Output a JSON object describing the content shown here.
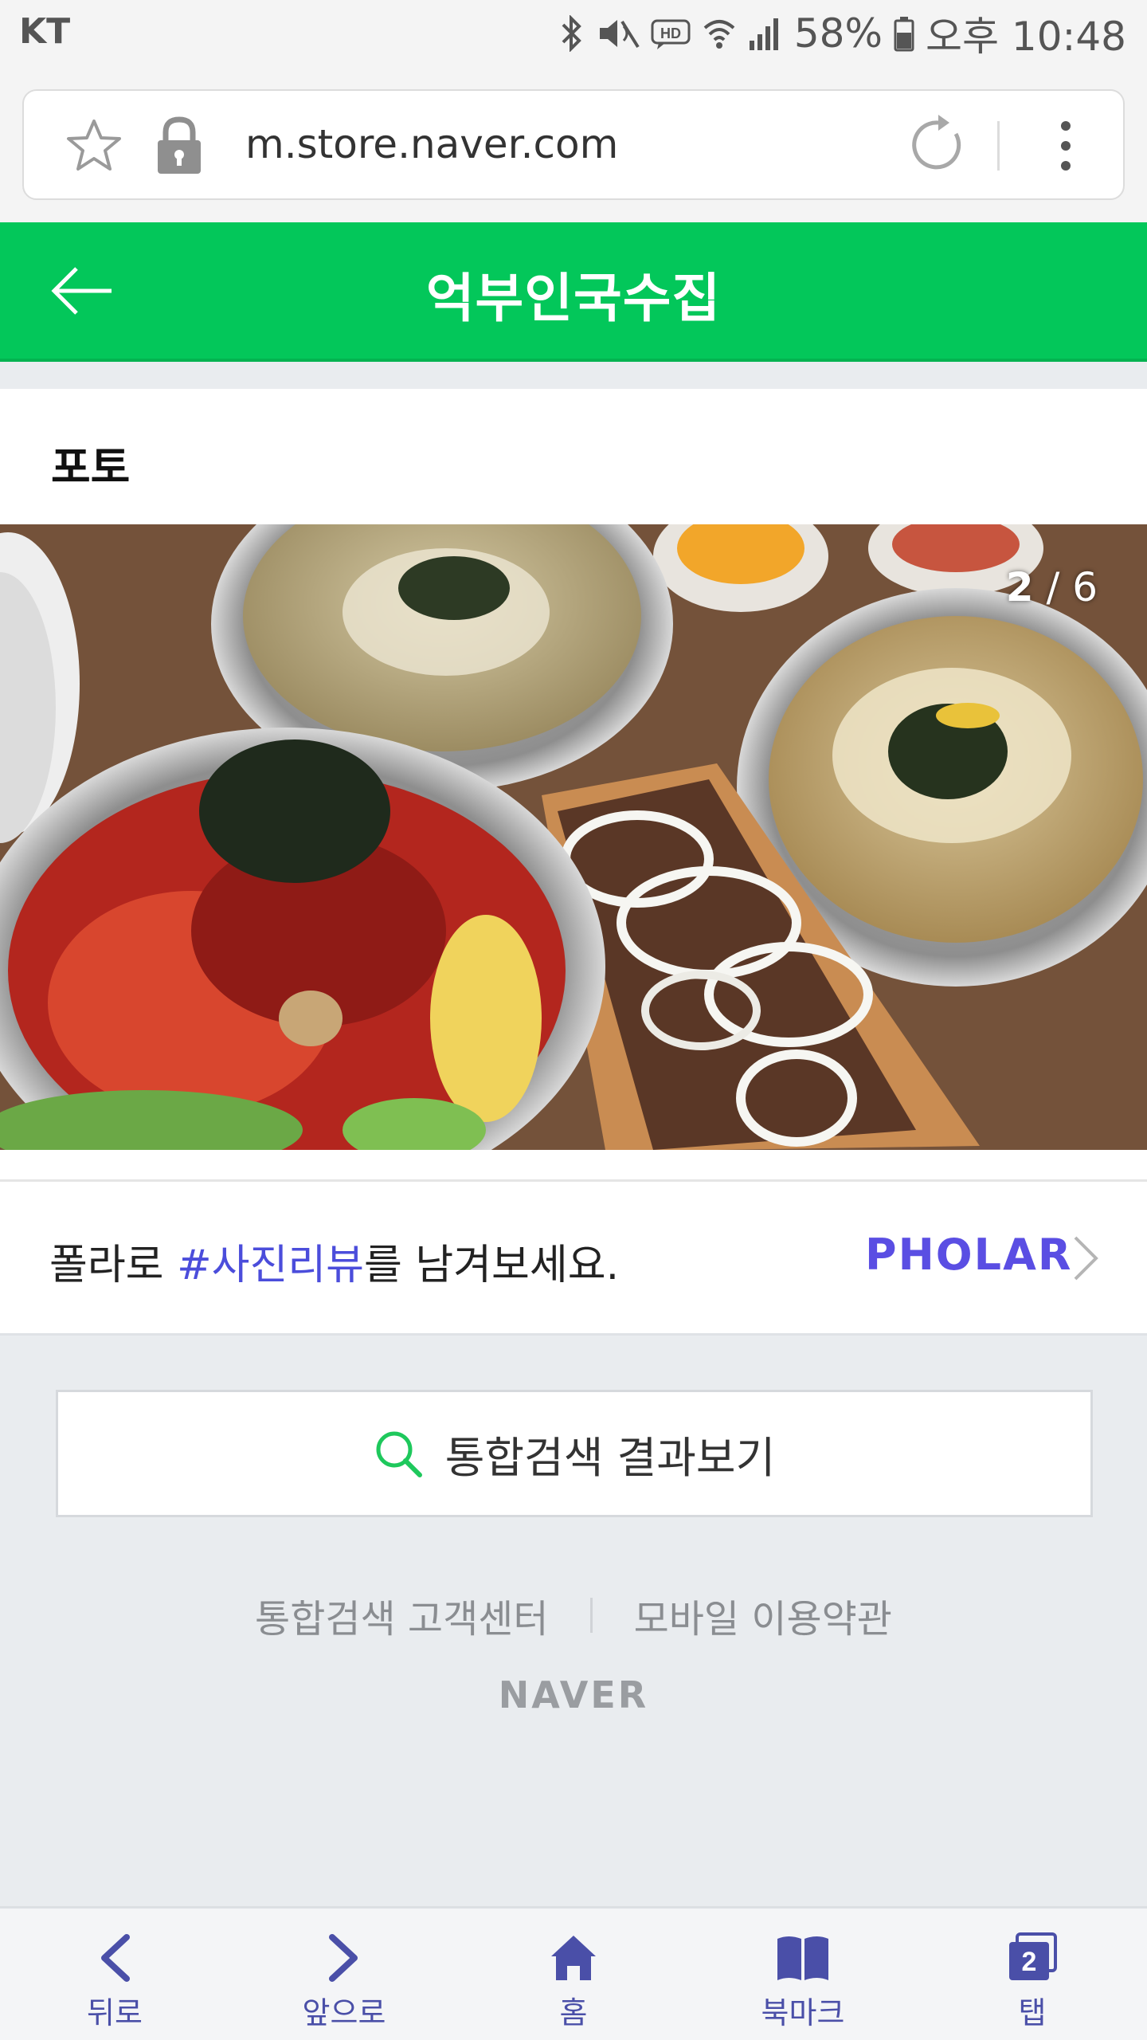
{
  "status_bar": {
    "carrier": "KT",
    "battery": "58%",
    "time": "오후 10:48"
  },
  "browser": {
    "url": "m.store.naver.com"
  },
  "header": {
    "title": "억부인국수집"
  },
  "photo_section": {
    "title": "포토",
    "counter_current": "2",
    "counter_separator": " / ",
    "counter_total": "6"
  },
  "pholar": {
    "text_before": "폴라로 ",
    "hashtag": "#사진리뷰",
    "text_after": "를 남겨보세요.",
    "logo": "PHOLAR"
  },
  "search": {
    "label": "통합검색 결과보기"
  },
  "footer": {
    "links": [
      "통합검색 고객센터",
      "모바일 이용약관"
    ],
    "logo": "NAVER"
  },
  "bottom_nav": {
    "items": [
      {
        "label": "뒤로",
        "icon": "back-icon"
      },
      {
        "label": "앞으로",
        "icon": "forward-icon"
      },
      {
        "label": "홈",
        "icon": "home-icon"
      },
      {
        "label": "북마크",
        "icon": "bookmark-icon"
      },
      {
        "label": "탭",
        "icon": "tabs-icon",
        "badge": "2"
      }
    ]
  },
  "colors": {
    "brand_green": "#03c75a",
    "pholar_purple": "#5a4ee3",
    "nav_blue": "#4a4fa8"
  }
}
